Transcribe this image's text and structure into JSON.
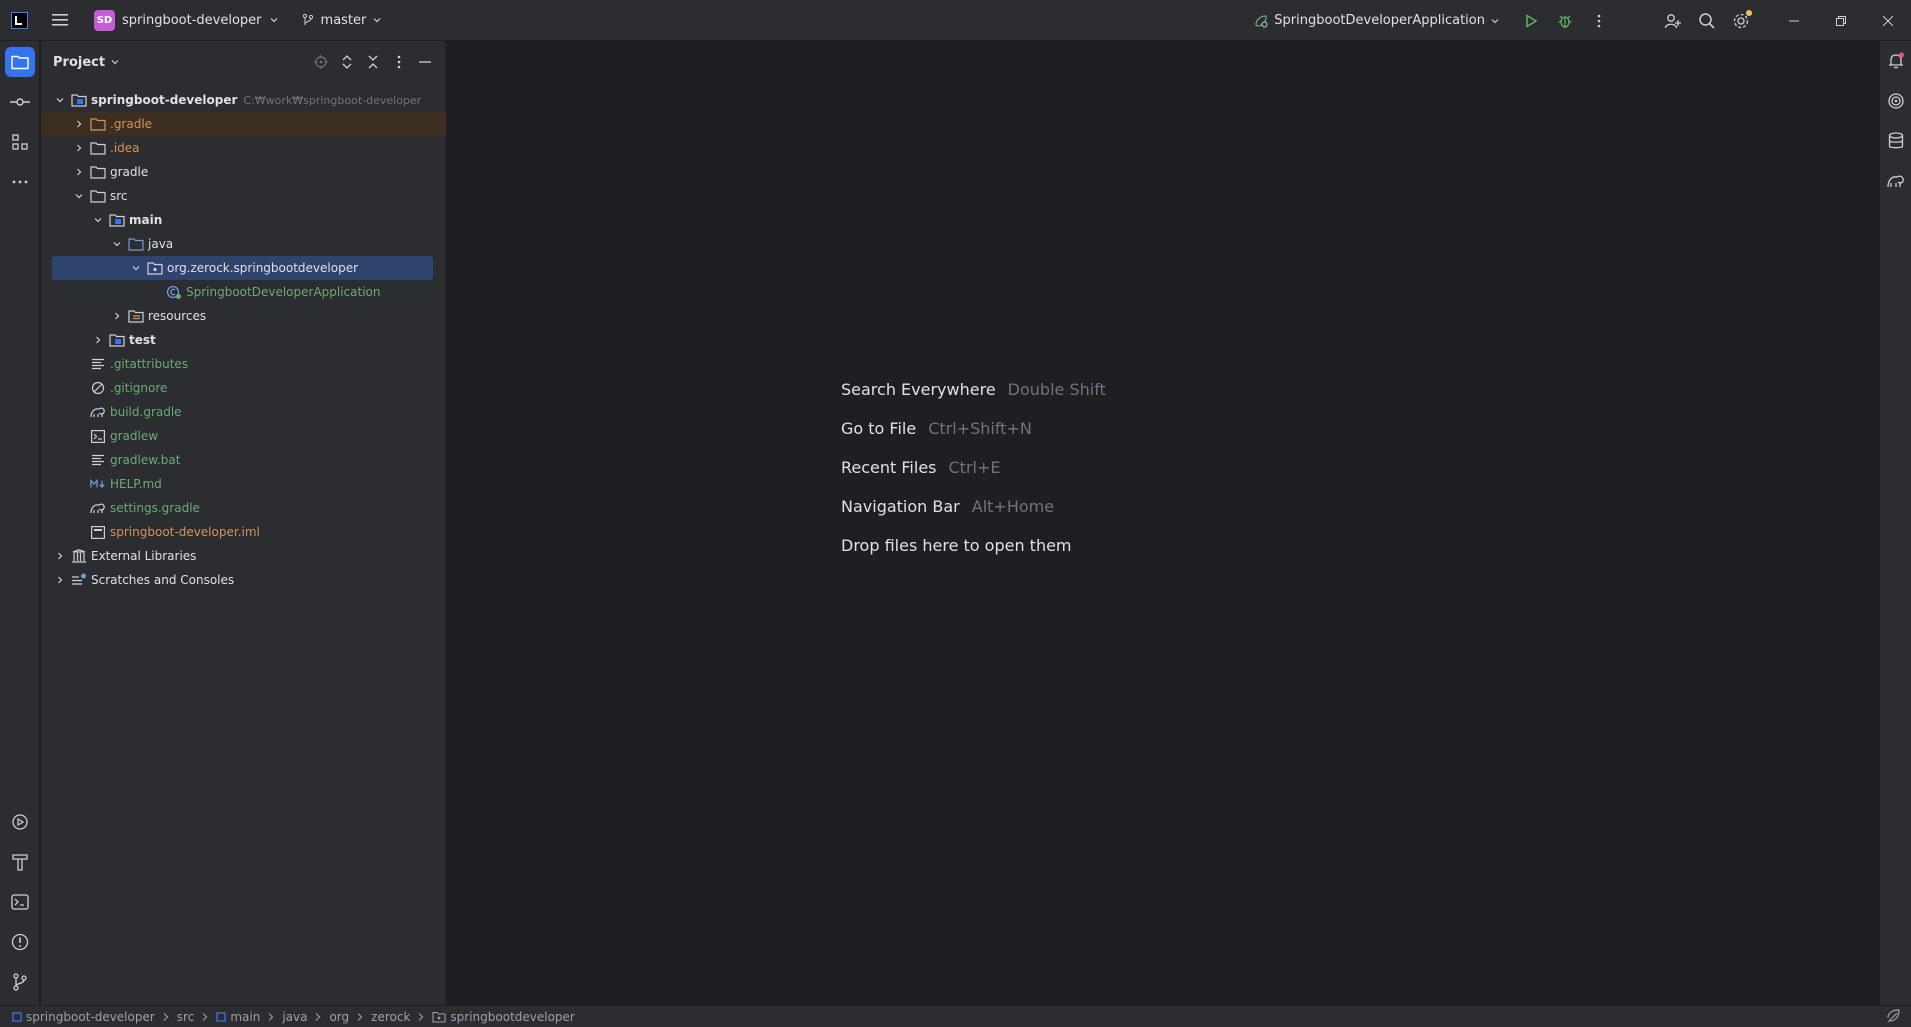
{
  "titlebar": {
    "project_initials": "SD",
    "project_name": "springboot-developer",
    "branch": "master",
    "run_config": "SpringbootDeveloperApplication",
    "icons": [
      "intellij-logo-icon",
      "hamburger-menu-icon",
      "chevron-down-icon",
      "git-branch-icon",
      "spring-boot-run-icon",
      "run-icon",
      "debug-icon",
      "more-icon",
      "add-user-icon",
      "search-icon",
      "settings-icon",
      "minimize-icon",
      "restore-icon",
      "close-icon"
    ]
  },
  "left_strip": {
    "top_tools": [
      "project-icon",
      "commit-icon",
      "structure-icon",
      "more-tools-icon"
    ],
    "bottom_tools": [
      "services-icon",
      "build-icon",
      "terminal-icon",
      "problems-icon",
      "git-icon"
    ]
  },
  "project_panel": {
    "title": "Project",
    "tree": [
      {
        "label": "springboot-developer",
        "hint": "C:₩work₩springboot-developer"
      },
      {
        "label": ".gradle"
      },
      {
        "label": ".idea"
      },
      {
        "label": "gradle"
      },
      {
        "label": "src"
      },
      {
        "label": "main"
      },
      {
        "label": "java"
      },
      {
        "label": "org.zerock.springbootdeveloper"
      },
      {
        "label": "SpringbootDeveloperApplication"
      },
      {
        "label": "resources"
      },
      {
        "label": "test"
      },
      {
        "label": ".gitattributes"
      },
      {
        "label": ".gitignore"
      },
      {
        "label": "build.gradle"
      },
      {
        "label": "gradlew"
      },
      {
        "label": "gradlew.bat"
      },
      {
        "label": "HELP.md"
      },
      {
        "label": "settings.gradle"
      },
      {
        "label": "springboot-developer.iml"
      },
      {
        "label": "External Libraries"
      },
      {
        "label": "Scratches and Consoles"
      }
    ]
  },
  "editor_hints": [
    {
      "action": "Search Everywhere",
      "key": "Double Shift"
    },
    {
      "action": "Go to File",
      "key": "Ctrl+Shift+N"
    },
    {
      "action": "Recent Files",
      "key": "Ctrl+E"
    },
    {
      "action": "Navigation Bar",
      "key": "Alt+Home"
    },
    {
      "action": "Drop files here to open them",
      "key": ""
    }
  ],
  "right_strip": [
    "notifications-icon",
    "ai-assistant-icon",
    "database-icon",
    "gradle-icon"
  ],
  "statusbar": {
    "breadcrumbs": [
      "springboot-developer",
      "src",
      "main",
      "java",
      "org",
      "zerock",
      "springbootdeveloper"
    ]
  },
  "colors": {
    "accent": "#3574f0",
    "selection": "#2e436e",
    "excluded_bg": "#3d2e22",
    "orange_text": "#d3935b",
    "green_text": "#6aab73",
    "project_badge": "#c75bd6"
  }
}
